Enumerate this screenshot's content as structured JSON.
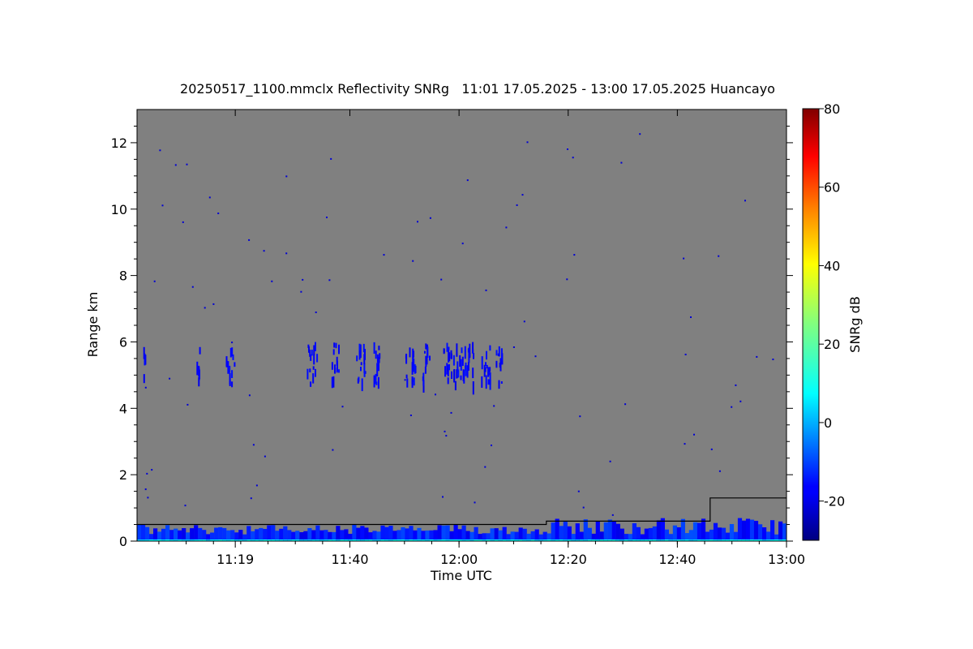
{
  "chart_data": {
    "type": "heatmap",
    "title": "20250517_1100.mmclx Reflectivity SNRg   11:01 17.05.2025 - 13:00 17.05.2025 Huancayo",
    "xlabel": "Time UTC",
    "ylabel": "Range km",
    "x_range": [
      "11:01",
      "13:00"
    ],
    "x_ticks": [
      "11:19",
      "11:40",
      "12:00",
      "12:20",
      "12:40",
      "13:00"
    ],
    "ylim": [
      0,
      13
    ],
    "y_ticks": [
      0,
      2,
      4,
      6,
      8,
      10,
      12
    ],
    "colorbar": {
      "label": "SNRg dB",
      "range": [
        -30,
        80
      ],
      "ticks": [
        -20,
        0,
        20,
        40,
        60,
        80
      ]
    },
    "background_color": "#808080",
    "features": [
      {
        "name": "cloud layer",
        "time_start": "11:02",
        "time_end": "12:12",
        "range_km": [
          4.8,
          6.0
        ],
        "snr_db": -20
      },
      {
        "name": "near-surface clutter",
        "time_start": "11:01",
        "time_end": "13:00",
        "range_km": [
          0,
          0.8
        ],
        "snr_db": [
          -20,
          10
        ]
      }
    ],
    "overlay_line": {
      "description": "black step line",
      "points": [
        [
          "11:01",
          0.5
        ],
        [
          "12:16",
          0.5
        ],
        [
          "12:16",
          0.6
        ],
        [
          "12:46",
          0.6
        ],
        [
          "12:46",
          1.3
        ],
        [
          "13:00",
          1.3
        ]
      ]
    }
  }
}
